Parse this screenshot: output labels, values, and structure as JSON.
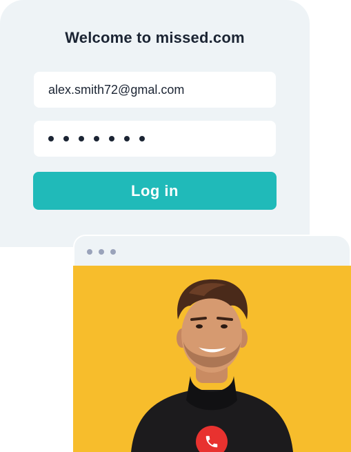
{
  "login": {
    "title": "Welcome to missed.com",
    "email_value": "alex.smith72@gmal.com",
    "password_mask_length": 7,
    "login_label": "Log in"
  },
  "video_call": {
    "window_dots": 3,
    "end_call_icon": "phone-hangup-icon"
  },
  "colors": {
    "card_bg": "#eef3f6",
    "accent": "#20bab9",
    "video_bg": "#f7bd2c",
    "end_call": "#e8322f",
    "text": "#1b2433"
  }
}
